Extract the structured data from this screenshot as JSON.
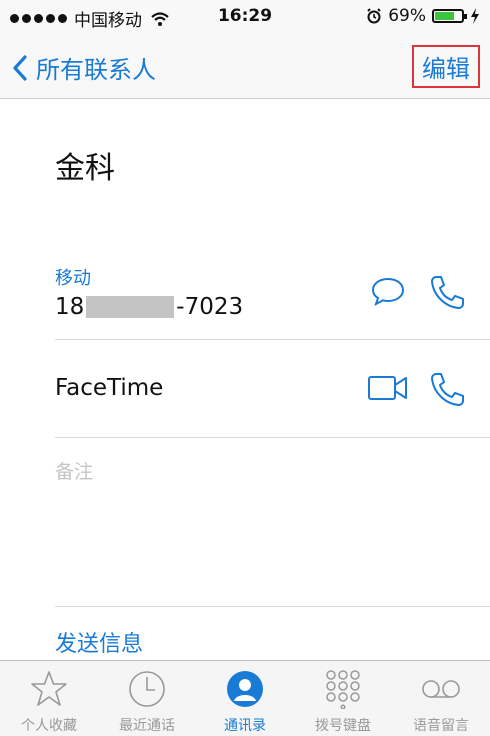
{
  "status_bar": {
    "carrier": "中国移动",
    "time": "16:29",
    "battery_percent_text": "69%",
    "battery_level": 0.69
  },
  "nav": {
    "back_label": "所有联系人",
    "edit_label": "编辑"
  },
  "contact": {
    "name": "金科",
    "phone_label": "移动",
    "phone_prefix": "18",
    "phone_suffix": "-7023",
    "facetime_label": "FaceTime",
    "notes_placeholder": "备注",
    "send_message_label": "发送信息"
  },
  "tabs": [
    {
      "label": "个人收藏",
      "icon": "star-icon"
    },
    {
      "label": "最近通话",
      "icon": "clock-icon"
    },
    {
      "label": "通讯录",
      "icon": "contacts-icon",
      "active": true
    },
    {
      "label": "拨号键盘",
      "icon": "keypad-icon"
    },
    {
      "label": "语音留言",
      "icon": "voicemail-icon"
    }
  ],
  "colors": {
    "accent": "#1a7bd6",
    "highlight_border": "#d9353a",
    "battery_fill": "#3ec43c",
    "muted": "#999999"
  }
}
